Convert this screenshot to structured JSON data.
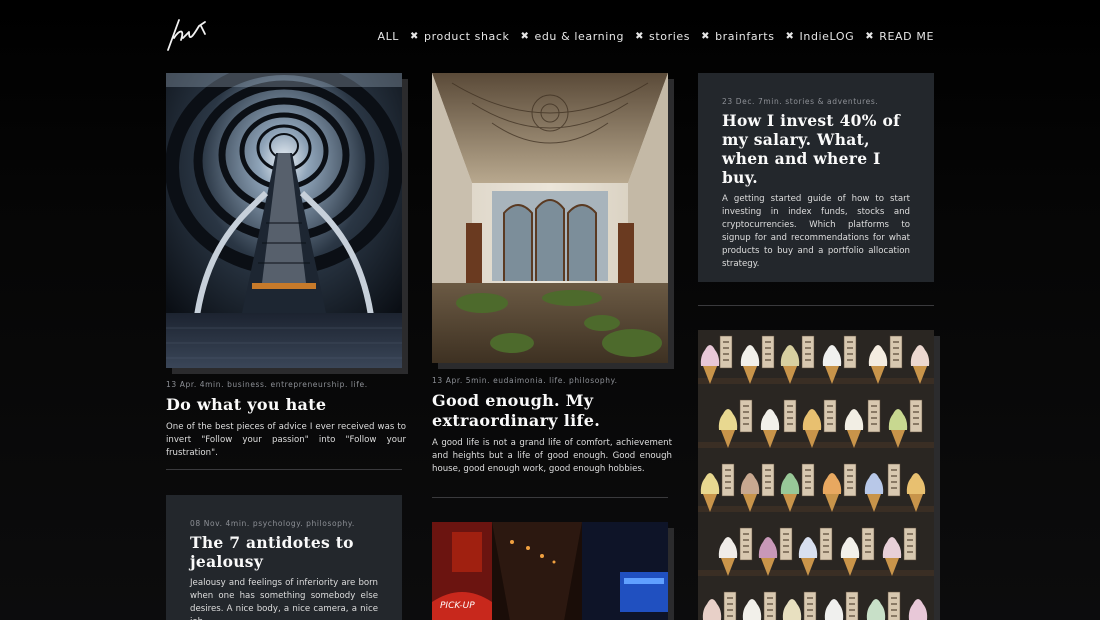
{
  "nav": {
    "all": "ALL",
    "items": [
      "product shack",
      "edu & learning",
      "stories",
      "brainfarts",
      "IndieLOG",
      "READ ME"
    ]
  },
  "posts": {
    "p1": {
      "meta": "13 Apr. 4min. business. entrepreneurship. life.",
      "title": "Do what you hate",
      "desc": "One of the best pieces of advice I ever received was to invert \"Follow your passion\" into \"Follow your frustration\"."
    },
    "p2": {
      "meta": "13 Apr. 5min. eudaimonia. life. philosophy.",
      "title": "Good enough. My extraordinary life.",
      "desc": "A good life is not a grand life of comfort, achievement and heights but a life of good enough. Good enough house, good enough work, good enough hobbies."
    },
    "p3": {
      "meta": "23 Dec. 7min. stories & adventures.",
      "title": "How I invest 40% of my salary. What, when and where I buy.",
      "desc": "A getting started guide of how to start investing in index funds, stocks and cryptocurrencies. Which platforms to signup for and recommendations for what products to buy and a portfolio allocation strategy."
    },
    "p4": {
      "meta": "08 Nov. 4min. psychology. philosophy.",
      "title": "The 7 antidotes to jealousy",
      "desc": "Jealousy and feelings of inferiority are born when one has something somebody else desires. A nice body, a nice camera, a nice job"
    }
  },
  "images": {
    "escalator": "escalator-photo",
    "ruin": "abandoned-room-photo",
    "icecream": "ice-cream-display-photo",
    "street": "night-street-photo",
    "sign_text": "PICK-UP"
  },
  "colors": {
    "background": "#000000",
    "card": "#23272c",
    "shadow": "#2b2b2d",
    "text": "#fafafa",
    "meta": "#8d9096"
  }
}
